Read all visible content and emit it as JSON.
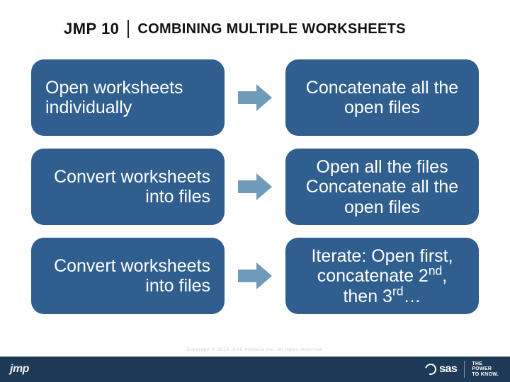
{
  "header": {
    "badge": "JMP 10",
    "title": "COMBINING MULTIPLE WORKSHEETS"
  },
  "rows": [
    {
      "left": "Open worksheets individually",
      "left_align": "left",
      "right": "Concatenate all the open files"
    },
    {
      "left": "Convert worksheets into files",
      "left_align": "right",
      "right": "Open all the files Concatenate all the open files"
    },
    {
      "left": "Convert worksheets into files",
      "left_align": "right",
      "right_html": "Iterate: Open first, concatenate 2<span class=\"ord\">nd</span>, then 3<span class=\"ord\">rd</span>…"
    }
  ],
  "footer": {
    "copyright": "Copyright © 2013, SAS Institute Inc. All rights reserved.",
    "jmp_small": "jmp",
    "sas": "sas",
    "tagline": "THE\nPOWER\nTO KNOW."
  },
  "colors": {
    "card_bg": "#305f8f",
    "arrow": "#6f9bb8",
    "footer_bg": "#1f3a57"
  }
}
